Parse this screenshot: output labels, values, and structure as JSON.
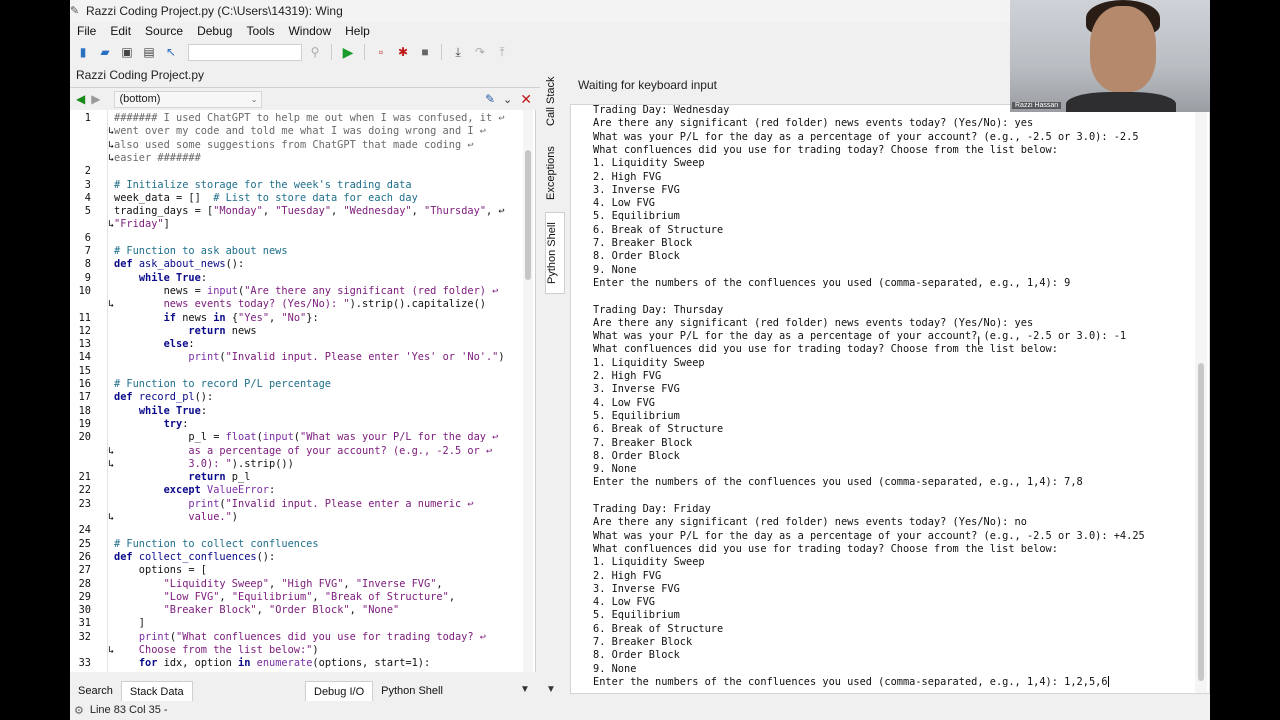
{
  "window": {
    "title": "Razzi Coding Project.py (C:\\Users\\14319): Wing"
  },
  "menu": [
    "File",
    "Edit",
    "Source",
    "Debug",
    "Tools",
    "Window",
    "Help"
  ],
  "toolbar": {
    "icons": [
      "new-file-icon",
      "open-folder-icon",
      "save-icon",
      "save-all-icon",
      "pointer-icon",
      "search-icon",
      "play-icon",
      "new-window-icon",
      "bug-icon",
      "stop-icon",
      "step-into-icon",
      "step-over-icon",
      "step-out-icon"
    ]
  },
  "editor": {
    "tab_label": "Razzi Coding Project.py",
    "scope": "(bottom)",
    "lines": [
      {
        "n": "1",
        "segs": [
          [
            "cm",
            "####### I used ChatGPT to help me out when I was confused, it ↩"
          ]
        ]
      },
      {
        "n": "",
        "segs": [
          [
            "cm",
            "went over my code and told me what I was doing wrong and I ↩"
          ]
        ]
      },
      {
        "n": "",
        "segs": [
          [
            "cm",
            "also used some suggestions from ChatGPT that made coding ↩"
          ]
        ]
      },
      {
        "n": "",
        "segs": [
          [
            "cm",
            "easier #######"
          ]
        ]
      },
      {
        "n": "2",
        "segs": []
      },
      {
        "n": "3",
        "segs": [
          [
            "hc",
            "# Initialize storage for the week's trading data"
          ]
        ]
      },
      {
        "n": "4",
        "segs": [
          [
            "tx",
            "week_data = [] "
          ],
          [
            "hc",
            " # List to store data for each day"
          ]
        ]
      },
      {
        "n": "5",
        "segs": [
          [
            "tx",
            "trading_days = ["
          ],
          [
            "st",
            "\"Monday\""
          ],
          [
            "tx",
            ", "
          ],
          [
            "st",
            "\"Tuesday\""
          ],
          [
            "tx",
            ", "
          ],
          [
            "st",
            "\"Wednesday\""
          ],
          [
            "tx",
            ", "
          ],
          [
            "st",
            "\"Thursday\""
          ],
          [
            "tx",
            ", ↩"
          ]
        ]
      },
      {
        "n": "",
        "segs": [
          [
            "st",
            "\"Friday\""
          ],
          [
            "tx",
            "]"
          ]
        ]
      },
      {
        "n": "6",
        "segs": []
      },
      {
        "n": "7",
        "segs": [
          [
            "hc",
            "# Function to ask about news"
          ]
        ]
      },
      {
        "n": "8",
        "segs": [
          [
            "kw",
            "def "
          ],
          [
            "fn",
            "ask_about_news"
          ],
          [
            "tx",
            "():"
          ]
        ]
      },
      {
        "n": "9",
        "segs": [
          [
            "tx",
            "    "
          ],
          [
            "kw",
            "while True"
          ],
          [
            "tx",
            ":"
          ]
        ]
      },
      {
        "n": "10",
        "segs": [
          [
            "tx",
            "        news = "
          ],
          [
            "bi",
            "input"
          ],
          [
            "tx",
            "("
          ],
          [
            "st",
            "\"Are there any significant (red folder) ↩"
          ]
        ]
      },
      {
        "n": "",
        "segs": [
          [
            "st",
            "        news events today? (Yes/No): \""
          ],
          [
            "tx",
            ").strip().capitalize()"
          ]
        ]
      },
      {
        "n": "11",
        "segs": [
          [
            "tx",
            "        "
          ],
          [
            "kw",
            "if"
          ],
          [
            "tx",
            " news "
          ],
          [
            "kw",
            "in"
          ],
          [
            "tx",
            " {"
          ],
          [
            "st",
            "\"Yes\""
          ],
          [
            "tx",
            ", "
          ],
          [
            "st",
            "\"No\""
          ],
          [
            "tx",
            "}:"
          ]
        ]
      },
      {
        "n": "12",
        "segs": [
          [
            "tx",
            "            "
          ],
          [
            "kw",
            "return"
          ],
          [
            "tx",
            " news"
          ]
        ]
      },
      {
        "n": "13",
        "segs": [
          [
            "tx",
            "        "
          ],
          [
            "kw",
            "else"
          ],
          [
            "tx",
            ":"
          ]
        ]
      },
      {
        "n": "14",
        "segs": [
          [
            "tx",
            "            "
          ],
          [
            "bi",
            "print"
          ],
          [
            "tx",
            "("
          ],
          [
            "st",
            "\"Invalid input. Please enter 'Yes' or 'No'.\""
          ],
          [
            "tx",
            ")"
          ]
        ]
      },
      {
        "n": "15",
        "segs": []
      },
      {
        "n": "16",
        "segs": [
          [
            "hc",
            "# Function to record P/L percentage"
          ]
        ]
      },
      {
        "n": "17",
        "segs": [
          [
            "kw",
            "def "
          ],
          [
            "fn",
            "record_pl"
          ],
          [
            "tx",
            "():"
          ]
        ]
      },
      {
        "n": "18",
        "segs": [
          [
            "tx",
            "    "
          ],
          [
            "kw",
            "while True"
          ],
          [
            "tx",
            ":"
          ]
        ]
      },
      {
        "n": "19",
        "segs": [
          [
            "tx",
            "        "
          ],
          [
            "kw",
            "try"
          ],
          [
            "tx",
            ":"
          ]
        ]
      },
      {
        "n": "20",
        "segs": [
          [
            "tx",
            "            p_l = "
          ],
          [
            "bi",
            "float"
          ],
          [
            "tx",
            "("
          ],
          [
            "bi",
            "input"
          ],
          [
            "tx",
            "("
          ],
          [
            "st",
            "\"What was your P/L for the day ↩"
          ]
        ]
      },
      {
        "n": "",
        "segs": [
          [
            "st",
            "            as a percentage of your account? (e.g., -2.5 or ↩"
          ]
        ]
      },
      {
        "n": "",
        "segs": [
          [
            "st",
            "            3.0): \""
          ],
          [
            "tx",
            ").strip())"
          ]
        ]
      },
      {
        "n": "21",
        "segs": [
          [
            "tx",
            "            "
          ],
          [
            "kw",
            "return"
          ],
          [
            "tx",
            " p_l"
          ]
        ]
      },
      {
        "n": "22",
        "segs": [
          [
            "tx",
            "        "
          ],
          [
            "kw",
            "except"
          ],
          [
            "tx",
            " "
          ],
          [
            "bi",
            "ValueError"
          ],
          [
            "tx",
            ":"
          ]
        ]
      },
      {
        "n": "23",
        "segs": [
          [
            "tx",
            "            "
          ],
          [
            "bi",
            "print"
          ],
          [
            "tx",
            "("
          ],
          [
            "st",
            "\"Invalid input. Please enter a numeric ↩"
          ]
        ]
      },
      {
        "n": "",
        "segs": [
          [
            "st",
            "            value.\""
          ],
          [
            "tx",
            ")"
          ]
        ]
      },
      {
        "n": "24",
        "segs": []
      },
      {
        "n": "25",
        "segs": [
          [
            "hc",
            "# Function to collect confluences"
          ]
        ]
      },
      {
        "n": "26",
        "segs": [
          [
            "kw",
            "def "
          ],
          [
            "fn",
            "collect_confluences"
          ],
          [
            "tx",
            "():"
          ]
        ]
      },
      {
        "n": "27",
        "segs": [
          [
            "tx",
            "    options = ["
          ]
        ]
      },
      {
        "n": "28",
        "segs": [
          [
            "tx",
            "        "
          ],
          [
            "st",
            "\"Liquidity Sweep\""
          ],
          [
            "tx",
            ", "
          ],
          [
            "st",
            "\"High FVG\""
          ],
          [
            "tx",
            ", "
          ],
          [
            "st",
            "\"Inverse FVG\""
          ],
          [
            "tx",
            ","
          ]
        ]
      },
      {
        "n": "29",
        "segs": [
          [
            "tx",
            "        "
          ],
          [
            "st",
            "\"Low FVG\""
          ],
          [
            "tx",
            ", "
          ],
          [
            "st",
            "\"Equilibrium\""
          ],
          [
            "tx",
            ", "
          ],
          [
            "st",
            "\"Break of Structure\""
          ],
          [
            "tx",
            ","
          ]
        ]
      },
      {
        "n": "30",
        "segs": [
          [
            "tx",
            "        "
          ],
          [
            "st",
            "\"Breaker Block\""
          ],
          [
            "tx",
            ", "
          ],
          [
            "st",
            "\"Order Block\""
          ],
          [
            "tx",
            ", "
          ],
          [
            "st",
            "\"None\""
          ]
        ]
      },
      {
        "n": "31",
        "segs": [
          [
            "tx",
            "    ]"
          ]
        ]
      },
      {
        "n": "32",
        "segs": [
          [
            "tx",
            "    "
          ],
          [
            "bi",
            "print"
          ],
          [
            "tx",
            "("
          ],
          [
            "st",
            "\"What confluences did you use for trading today? ↩"
          ]
        ]
      },
      {
        "n": "",
        "segs": [
          [
            "st",
            "    Choose from the list below:\""
          ],
          [
            "tx",
            ")"
          ]
        ]
      },
      {
        "n": "33",
        "segs": [
          [
            "tx",
            "    "
          ],
          [
            "kw",
            "for"
          ],
          [
            "tx",
            " idx, option "
          ],
          [
            "kw",
            "in"
          ],
          [
            "tx",
            " "
          ],
          [
            "bi",
            "enumerate"
          ],
          [
            "tx",
            "(options, start=1):"
          ]
        ]
      }
    ]
  },
  "shell": {
    "status": "Waiting for keyboard input",
    "lines": [
      "Trading Day: Wednesday",
      "Are there any significant (red folder) news events today? (Yes/No): yes",
      "What was your P/L for the day as a percentage of your account? (e.g., -2.5 or 3.0): -2.5",
      "What confluences did you use for trading today? Choose from the list below:",
      "1. Liquidity Sweep",
      "2. High FVG",
      "3. Inverse FVG",
      "4. Low FVG",
      "5. Equilibrium",
      "6. Break of Structure",
      "7. Breaker Block",
      "8. Order Block",
      "9. None",
      "Enter the numbers of the confluences you used (comma-separated, e.g., 1,4): 9",
      "",
      "Trading Day: Thursday",
      "Are there any significant (red folder) news events today? (Yes/No): yes",
      "What was your P/L for the day as a percentage of your account? (e.g., -2.5 or 3.0): -1",
      "What confluences did you use for trading today? Choose from the list below:",
      "1. Liquidity Sweep",
      "2. High FVG",
      "3. Inverse FVG",
      "4. Low FVG",
      "5. Equilibrium",
      "6. Break of Structure",
      "7. Breaker Block",
      "8. Order Block",
      "9. None",
      "Enter the numbers of the confluences you used (comma-separated, e.g., 1,4): 7,8",
      "",
      "Trading Day: Friday",
      "Are there any significant (red folder) news events today? (Yes/No): no",
      "What was your P/L for the day as a percentage of your account? (e.g., -2.5 or 3.0): +4.25",
      "What confluences did you use for trading today? Choose from the list below:",
      "1. Liquidity Sweep",
      "2. High FVG",
      "3. Inverse FVG",
      "4. Low FVG",
      "5. Equilibrium",
      "6. Break of Structure",
      "7. Breaker Block",
      "8. Order Block",
      "9. None",
      "Enter the numbers of the confluences you used (comma-separated, e.g., 1,4): 1,2,5,6"
    ]
  },
  "side_tabs": [
    "Call Stack",
    "Exceptions",
    "Python Shell"
  ],
  "bottom_tabs_left": [
    "Search",
    "Stack Data"
  ],
  "bottom_tabs_right": [
    "Debug I/O",
    "Python Shell"
  ],
  "status_bar": {
    "text": "Line 83 Col 35 -"
  },
  "webcam": {
    "label": "Razzi Hassan"
  }
}
